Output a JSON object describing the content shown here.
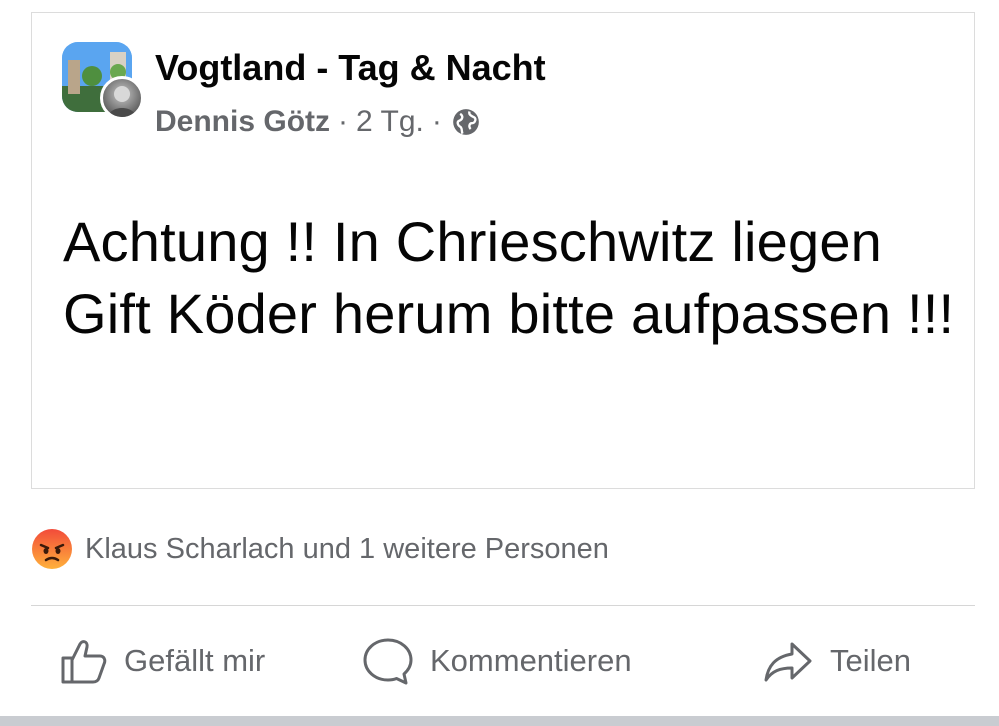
{
  "post": {
    "group_name": "Vogtland - Tag & Nacht",
    "author": "Dennis Götz",
    "separator": "·",
    "time": "2 Tg.",
    "privacy_icon": "globe-icon",
    "text": "Achtung !! In Chrieschwitz liegen Gift Köder herum bitte aufpassen !!!"
  },
  "reactions": {
    "icon": "angry-reaction-icon",
    "summary": "Klaus Scharlach und 1 weitere Personen"
  },
  "actions": {
    "like_label": "Gefällt mir",
    "comment_label": "Kommentieren",
    "share_label": "Teilen"
  },
  "colors": {
    "text_primary": "#050505",
    "text_secondary": "#65676b",
    "angry_reaction": "#f7714c"
  }
}
